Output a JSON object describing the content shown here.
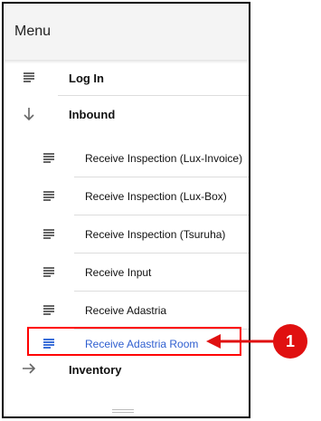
{
  "menu": {
    "title": "Menu",
    "items": [
      {
        "label": "Log In",
        "icon": "lines-icon"
      },
      {
        "label": "Inbound",
        "icon": "arrow-down-icon"
      },
      {
        "label": "Receive Inspection (Lux-Invoice)",
        "icon": "lines-icon"
      },
      {
        "label": "Receive Inspection (Lux-Box)",
        "icon": "lines-icon"
      },
      {
        "label": "Receive Inspection (Tsuruha)",
        "icon": "lines-icon"
      },
      {
        "label": "Receive Input",
        "icon": "lines-icon"
      },
      {
        "label": "Receive Adastria",
        "icon": "lines-icon"
      },
      {
        "label": "Receive Adastria Room",
        "icon": "lines-icon",
        "selected": true
      },
      {
        "label": "Inventory",
        "icon": "arrow-right-icon"
      }
    ]
  },
  "annotation": {
    "number": "1",
    "color": "#e01010"
  },
  "colors": {
    "accent": "#3b6fd8",
    "highlight_border": "#ff0000"
  }
}
